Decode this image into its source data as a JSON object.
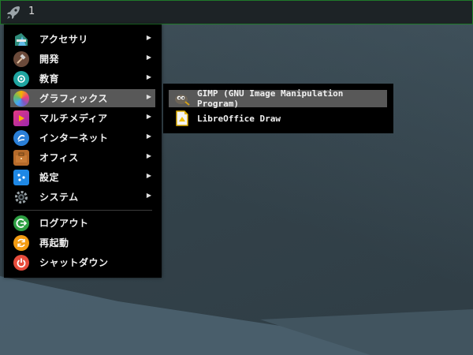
{
  "panel": {
    "workspace_label": "1",
    "launcher_icon": "rocket-icon"
  },
  "menu": {
    "items": [
      {
        "label": "アクセサリ",
        "icon": "accessories-icon",
        "has_submenu": true
      },
      {
        "label": "開発",
        "icon": "development-icon",
        "has_submenu": true
      },
      {
        "label": "教育",
        "icon": "education-icon",
        "has_submenu": true
      },
      {
        "label": "グラフィックス",
        "icon": "graphics-icon",
        "has_submenu": true,
        "active": true
      },
      {
        "label": "マルチメディア",
        "icon": "multimedia-icon",
        "has_submenu": true
      },
      {
        "label": "インターネット",
        "icon": "internet-icon",
        "has_submenu": true
      },
      {
        "label": "オフィス",
        "icon": "office-icon",
        "has_submenu": true
      },
      {
        "label": "設定",
        "icon": "settings-icon",
        "has_submenu": true
      },
      {
        "label": "システム",
        "icon": "system-icon",
        "has_submenu": true
      },
      {
        "label": "ログアウト",
        "icon": "logout-icon",
        "has_submenu": false
      },
      {
        "label": "再起動",
        "icon": "reboot-icon",
        "has_submenu": false
      },
      {
        "label": "シャットダウン",
        "icon": "shutdown-icon",
        "has_submenu": false
      }
    ],
    "arrow": "▶"
  },
  "submenu": {
    "items": [
      {
        "label": "GIMP (GNU Image Manipulation Program)",
        "icon": "gimp-icon",
        "active": true
      },
      {
        "label": "LibreOffice Draw",
        "icon": "libreoffice-draw-icon"
      }
    ]
  },
  "colors": {
    "panel_border": "#1f7a2a",
    "menu_bg": "#000000",
    "highlight": "#585858"
  }
}
